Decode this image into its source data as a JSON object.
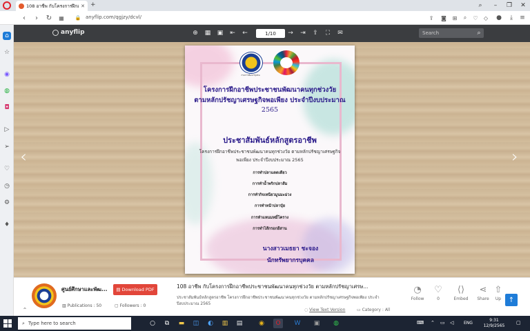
{
  "browser": {
    "tab_title": "108 อาชีพ กับโครงการฝึกอาชีพ...",
    "new_tab": "+",
    "url": "anyflip.com/qgjzy/dcvl/"
  },
  "viewer": {
    "logo": "anyflip",
    "page_indicator": "1/10",
    "search_placeholder": "Search"
  },
  "document": {
    "title_line1": "โครงการฝึกอาชีพประชาชนพัฒนาคนทุกช่วงวัย",
    "title_line2": "ตามหลักปรัชญาเศรษฐกิจพอเพียง ประจำปีงบประมาณ",
    "title_line3": "2565",
    "heading": "ประชาสัมพันธ์หลักสูตรอาชีพ",
    "sub_line1": "โครงการฝึกอาชีพประชาชนพัฒนาคนทุกช่วงวัย ตามหลักปรัชญาเศรษฐกิจ",
    "sub_line2": "พอเพียง ประจำปีงบประมาณ 2565",
    "courses": [
      "การทำปลาแดดเดียว",
      "การทำน้ำพริกปลาส้ม",
      "การทำกิจเหนียวมูนมะม่วง",
      "การทำหน้าปลาปุ๋ย",
      "การทำแหนมหมี่โคราง",
      "การทำไส้กรอกอีสาน"
    ],
    "signer_name": "นางสาวเมธยา ชะจอง",
    "signer_position": "นักทรัพยากรบุคคล",
    "seal1_caption": "กรมการพัฒนาชุมชน"
  },
  "info": {
    "publisher_name": "ศูนย์ศึกษาและพัฒ...",
    "download_label": "Download PDF",
    "publications": "Publications : 50",
    "followers": "Followers : 0",
    "book_title": "108 อาชีพ กับโครงการฝึกอาชีพประชาชนพัฒนาคนทุกช่วงวัย ตามหลักปรัชญาเศรษ...",
    "book_description": "ประชาสัมพันธ์หลักสูตรอาชีพ โครงการฝึกอาชีพประชาชนพัฒนาคนทุกช่วงวัย ตามหลักปรัชญาเศรษฐกิจพอเพียง ประจำปีงบประมาณ 2565",
    "view_text": "View Text Version",
    "category": "Category : All",
    "actions": {
      "follow": "Follow",
      "like_count": "0",
      "embed": "Embed",
      "share": "Share",
      "upload": "Up"
    }
  },
  "taskbar": {
    "search_placeholder": "Type here to search",
    "lang": "ENG",
    "time": "9:31",
    "date": "12/9/2565"
  },
  "colors": {
    "accent_red": "#e2463a",
    "title_blue": "#2a1a8a",
    "toolbar": "#3b3d40",
    "frame_pink": "#e9b8ce"
  }
}
